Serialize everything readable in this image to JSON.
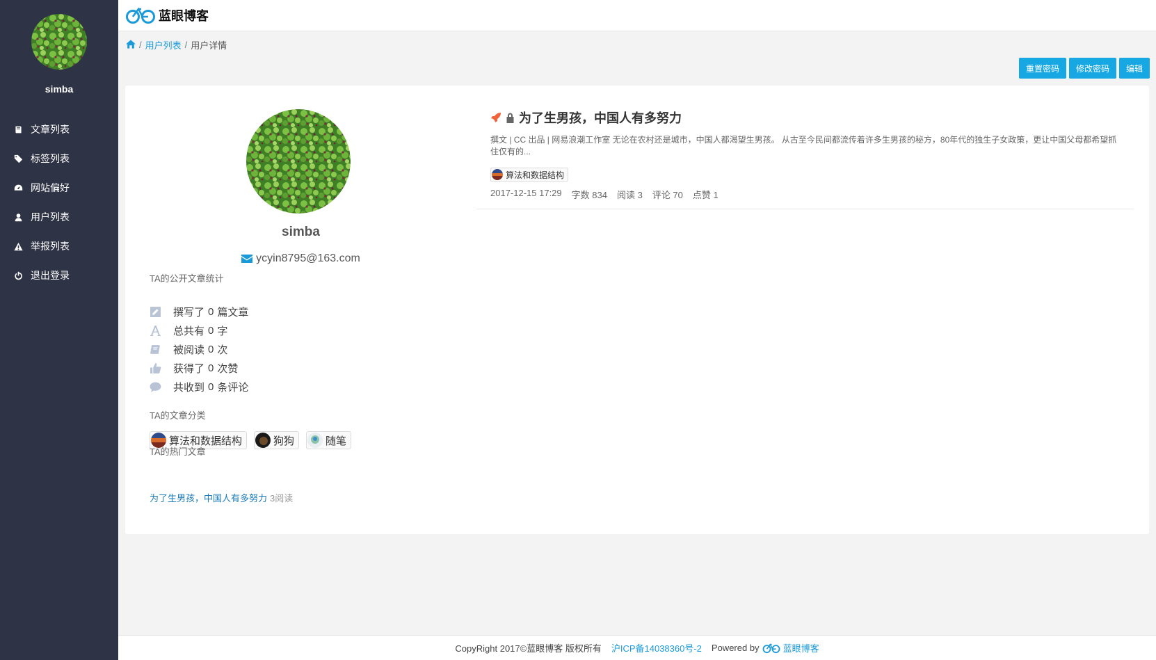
{
  "sidebar": {
    "username": "simba",
    "items": [
      {
        "label": "文章列表",
        "icon": "book-icon"
      },
      {
        "label": "标签列表",
        "icon": "tags-icon"
      },
      {
        "label": "网站偏好",
        "icon": "dashboard-icon"
      },
      {
        "label": "用户列表",
        "icon": "user-icon"
      },
      {
        "label": "举报列表",
        "icon": "warning-icon"
      },
      {
        "label": "退出登录",
        "icon": "power-icon"
      }
    ]
  },
  "header": {
    "logo_text": "蓝眼博客"
  },
  "breadcrumb": {
    "sep1": "/",
    "link": "用户列表",
    "sep2": "/",
    "current": "用户详情"
  },
  "actions": {
    "reset_password": "重置密码",
    "change_password": "修改密码",
    "edit": "编辑"
  },
  "profile": {
    "name": "simba",
    "email": "ycyin8795@163.com",
    "stats_title": "TA的公开文章统计",
    "stats": [
      {
        "pre": "撰写了",
        "num": "0",
        "post": "篇文章",
        "icon": "edit-icon"
      },
      {
        "pre": "总共有",
        "num": "0",
        "post": "字",
        "icon": "font-icon"
      },
      {
        "pre": "被阅读",
        "num": "0",
        "post": "次",
        "icon": "book-icon"
      },
      {
        "pre": "获得了",
        "num": "0",
        "post": "次赞",
        "icon": "thumbs-up-icon"
      },
      {
        "pre": "共收到",
        "num": "0",
        "post": "条评论",
        "icon": "comment-icon"
      }
    ],
    "categories_title": "TA的文章分类",
    "categories": [
      "算法和数据结构",
      "狗狗",
      "随笔"
    ],
    "hot_title": "TA的热门文章",
    "hot_article": "为了生男孩，中国人有多努力",
    "hot_reads": "3阅读"
  },
  "article": {
    "title": "为了生男孩，中国人有多努力",
    "summary": "撰文 | CC 出品 | 网易浪潮工作室 无论在农村还是城市，中国人都渴望生男孩。 从古至今民间都流传着许多生男孩的秘方，80年代的独生子女政策，更让中国父母都希望抓住仅有的...",
    "tag": "算法和数据结构",
    "date": "2017-12-15 17:29",
    "words": "字数 834",
    "reads": "阅读 3",
    "comments": "评论 70",
    "likes": "点赞 1"
  },
  "footer": {
    "copyright": "CopyRight 2017©蓝眼博客 版权所有",
    "icp": "沪ICP备14038360号-2",
    "powered_by": "Powered by",
    "brand": "蓝眼博客"
  }
}
